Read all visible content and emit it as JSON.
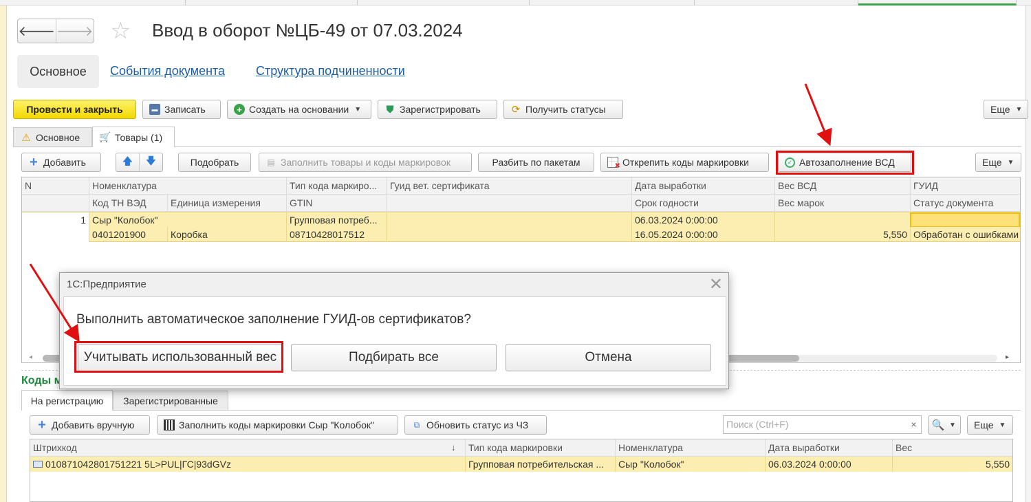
{
  "window": {
    "title": "Ввод в оборот №ЦБ-49 от 07.03.2024"
  },
  "nav": {
    "back": "back-arrow-icon",
    "forward": "forward-arrow-icon",
    "favorite": "star-icon"
  },
  "subtabs": [
    {
      "label": "Основное",
      "active": true
    },
    {
      "label": "События документа"
    },
    {
      "label": "Структура подчиненности"
    }
  ],
  "toolbar": {
    "post_close": "Провести и закрыть",
    "save": "Записать",
    "create_based": "Создать на основании",
    "register": "Зарегистрировать",
    "get_statuses": "Получить статусы",
    "more": "Еще"
  },
  "doc_tabs": [
    {
      "label": "Основное",
      "icon": "warning-icon"
    },
    {
      "label": "Товары (1)",
      "icon": "cart-icon",
      "active": true
    }
  ],
  "goods_toolbar": {
    "add": "Добавить",
    "pick": "Подобрать",
    "fill_codes": "Заполнить товары и коды маркировок",
    "split": "Разбить по пакетам",
    "detach": "Открепить коды маркировки",
    "autofill": "Автозаполнение ВСД",
    "more": "Еще"
  },
  "goods_table": {
    "header1": [
      "N",
      "Номенклатура",
      "Тип кода маркиро...",
      "Гуид вет. сертификата",
      "Дата выработки",
      "Вес ВСД",
      "ГУИД"
    ],
    "header2": [
      "Код ТН ВЭД",
      "Единица измерения",
      "GTIN",
      "Срок годности",
      "Вес марок",
      "Статус документа"
    ],
    "row1": {
      "n": "1",
      "nomenclature": "Сыр \"Колобок\"",
      "code_type": "Групповая потреб...",
      "production_date": "06.03.2024 0:00:00"
    },
    "row2": {
      "tnved": "0401201900",
      "unit": "Коробка",
      "gtin": "08710428017512",
      "expiry": "16.05.2024 0:00:00",
      "marks_weight": "5,550",
      "status": "Обработан с ошибками"
    }
  },
  "section": {
    "title": "Коды м"
  },
  "code_tabs": [
    {
      "label": "На регистрацию",
      "active": true
    },
    {
      "label": "Зарегистрированные"
    }
  ],
  "codes_toolbar": {
    "add_manual": "Добавить вручную",
    "fill_codes": "Заполнить коды маркировки Сыр \"Колобок\"",
    "update_status": "Обновить статус из ЧЗ",
    "search_placeholder": "Поиск (Ctrl+F)",
    "more": "Еще"
  },
  "codes_table": {
    "headers": [
      "Штрихкод",
      "Тип кода маркировки",
      "Номенклатура",
      "Дата выработки",
      "Вес"
    ],
    "sort_indicator": "↓",
    "row": {
      "barcode": "010871042801751221 5L>PUL|ГС|93dGVz",
      "code_type": "Групповая потребительская ...",
      "nomenclature": "Сыр \"Колобок\"",
      "production_date": "06.03.2024 0:00:00",
      "weight": "5,550"
    }
  },
  "dialog": {
    "title": "1С:Предприятие",
    "message": "Выполнить автоматическое заполнение ГУИД-ов сертификатов?",
    "buttons": [
      "Учитывать использованный вес",
      "Подбирать все",
      "Отмена"
    ]
  },
  "colors": {
    "highlight": "#e01010",
    "primary_button": "#f2d900",
    "link": "#1b5ea8",
    "row_selected": "#fbeeb0",
    "section_title": "#1a8a3c"
  }
}
